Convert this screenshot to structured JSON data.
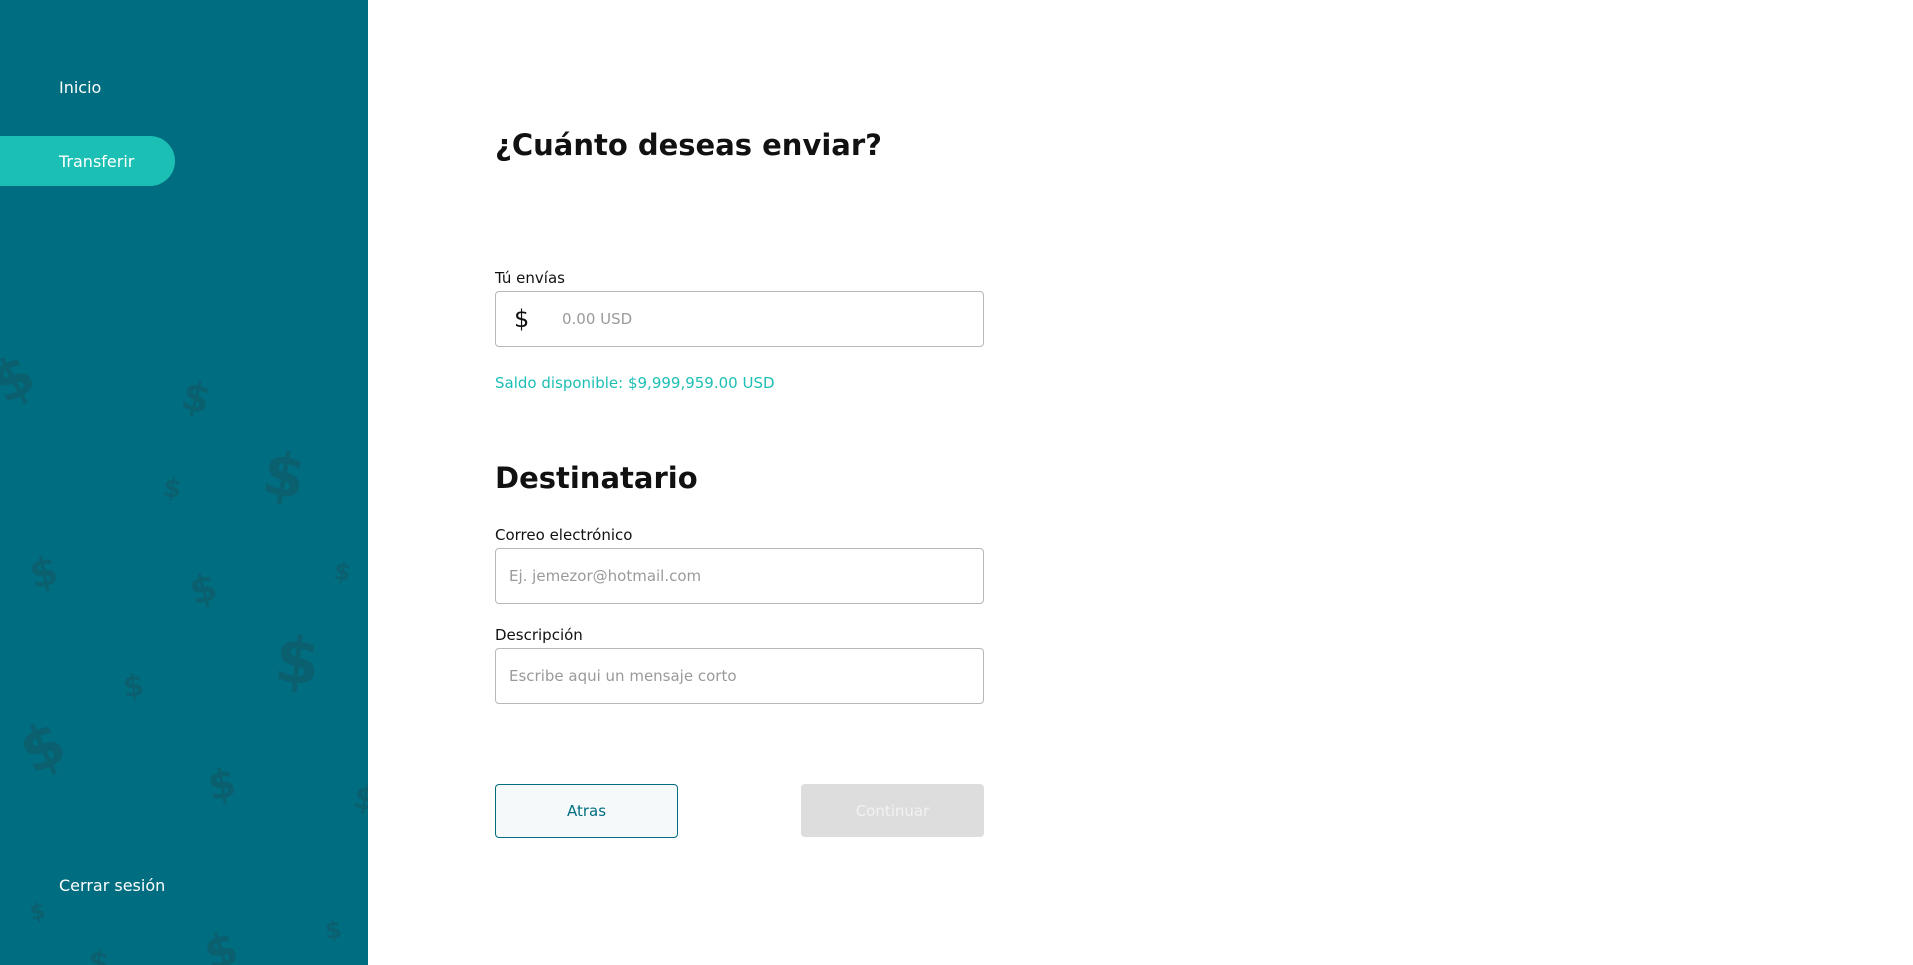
{
  "sidebar": {
    "items": [
      {
        "label": "Inicio",
        "active": false
      },
      {
        "label": "Transferir",
        "active": true
      }
    ],
    "logout_label": "Cerrar sesión",
    "background_icon": "dollar-icon",
    "colors": {
      "background": "#006e80",
      "active": "#1cbfb4"
    }
  },
  "main": {
    "title": "¿Cuánto deseas enviar?",
    "amount": {
      "label": "Tú envías",
      "currency_symbol": "$",
      "value": "",
      "placeholder": "0.00 USD"
    },
    "balance_text": "Saldo disponible: $9,999,959.00 USD",
    "recipient_title": "Destinatario",
    "email": {
      "label": "Correo electrónico",
      "value": "",
      "placeholder": "Ej. jemezor@hotmail.com"
    },
    "description": {
      "label": "Descripción",
      "value": "",
      "placeholder": "Escribe aqui un mensaje corto"
    },
    "buttons": {
      "back_label": "Atras",
      "continue_label": "Continuar",
      "continue_disabled": true
    }
  }
}
